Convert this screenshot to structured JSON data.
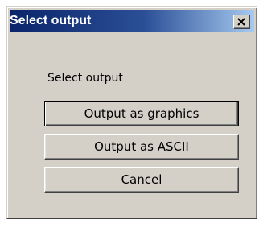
{
  "window": {
    "title": "Select output",
    "close_label": "X"
  },
  "content": {
    "prompt": "Select output"
  },
  "buttons": {
    "graphics_label": "Output as graphics",
    "ascii_label": "Output as ASCII",
    "cancel_label": "Cancel"
  },
  "colors": {
    "titlebar_start": "#0a246a",
    "titlebar_end": "#a6caf0",
    "dialog_face": "#d4d0c8"
  },
  "icons": {
    "close": "close-icon"
  }
}
